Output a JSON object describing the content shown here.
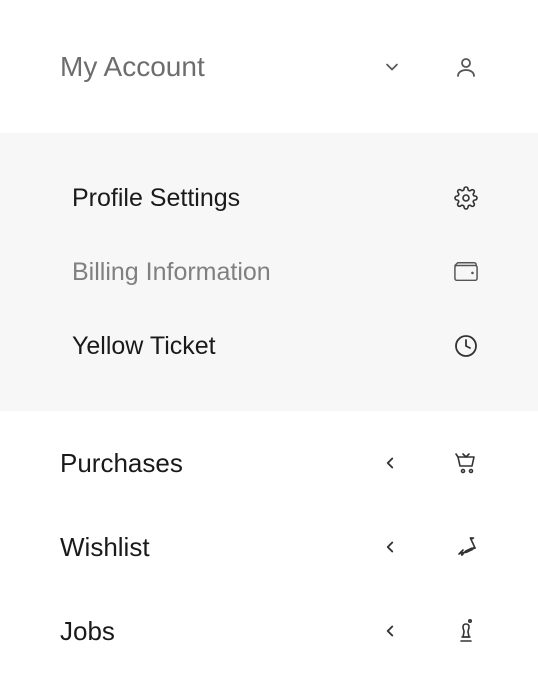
{
  "header": {
    "title": "My Account"
  },
  "submenu": {
    "items": [
      {
        "label": "Profile Settings",
        "muted": false
      },
      {
        "label": "Billing Information",
        "muted": true
      },
      {
        "label": "Yellow Ticket",
        "muted": false
      }
    ]
  },
  "main": {
    "items": [
      {
        "label": "Purchases"
      },
      {
        "label": "Wishlist"
      },
      {
        "label": "Jobs"
      }
    ]
  }
}
